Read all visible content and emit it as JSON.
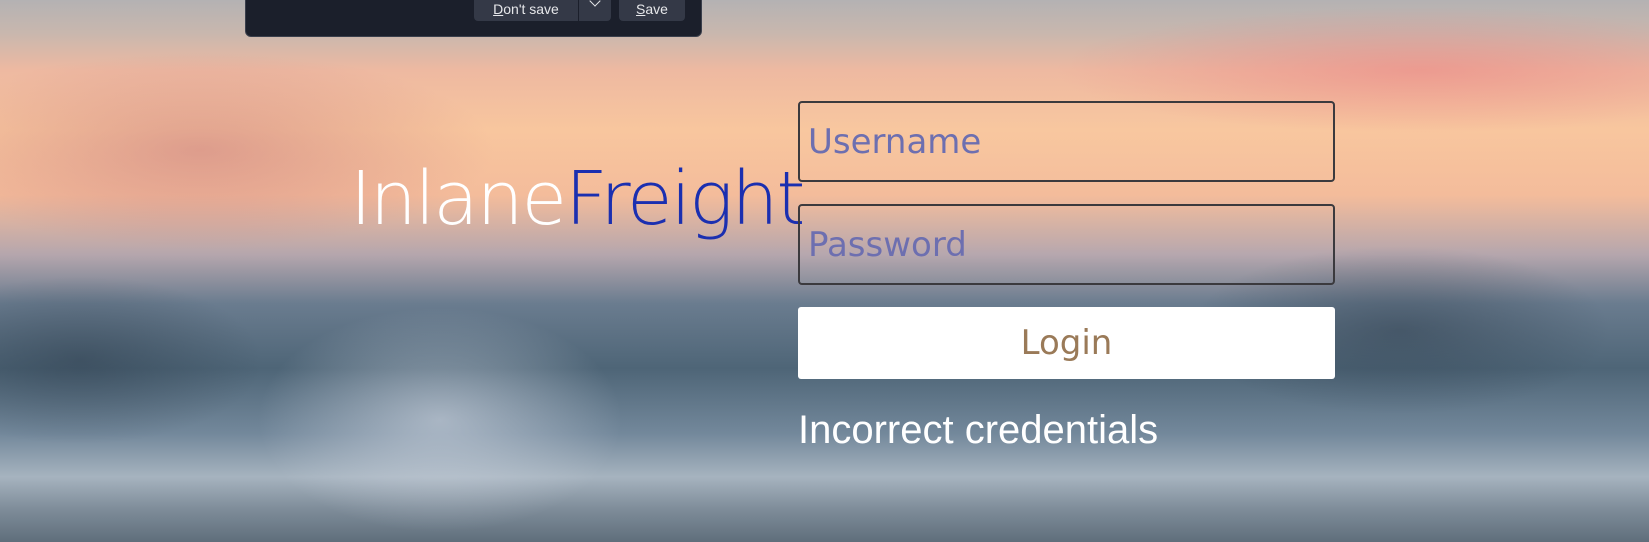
{
  "password_prompt": {
    "dont_save_mnemonic": "D",
    "dont_save_rest": "on't save",
    "more_options_icon": "chevron-down-icon",
    "save_mnemonic": "S",
    "save_rest": "ave"
  },
  "brand": {
    "part1": "Inlane",
    "part2": "Freight",
    "part1_color": "#ffffff",
    "part2_color": "#1b2fb0"
  },
  "login_form": {
    "username_placeholder": "Username",
    "password_placeholder": "Password",
    "login_label": "Login",
    "error_message": "Incorrect credentials"
  }
}
